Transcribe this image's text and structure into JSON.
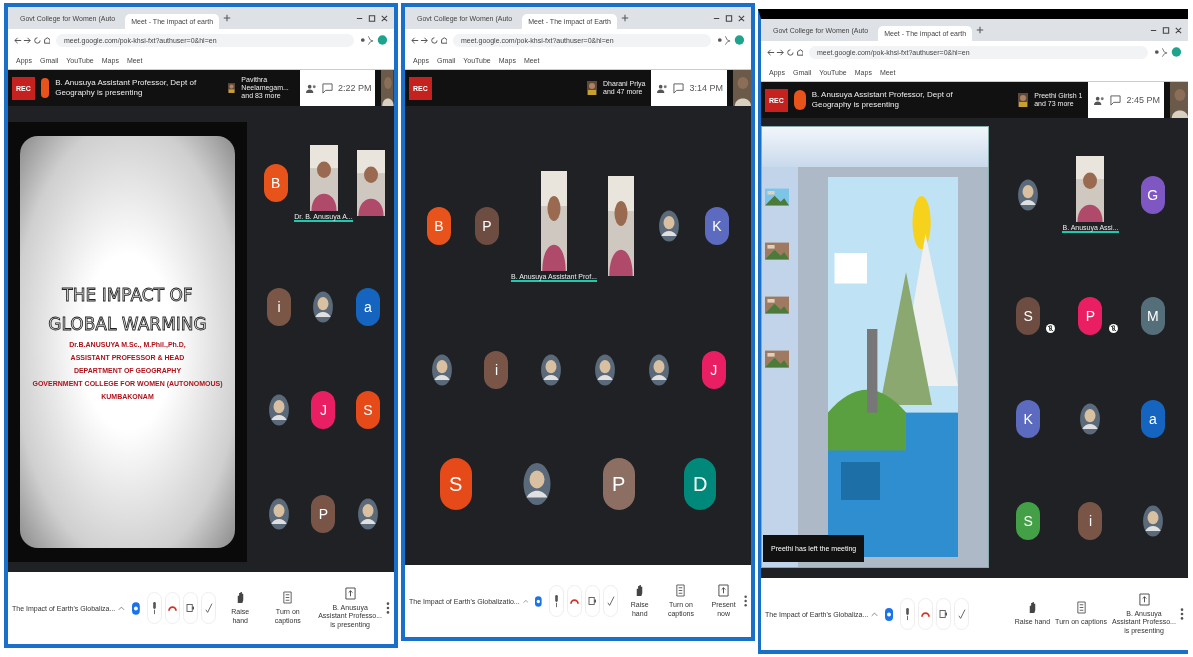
{
  "screens": [
    {
      "tabs": [
        {
          "label": "Govt College for Women (Auto",
          "selected": false
        },
        {
          "label": "Meet - The impact of earth",
          "selected": true
        }
      ],
      "url": "meet.google.com/pok-khsi-fxt?authuser=0&hl=en",
      "bookmarks": [
        "Apps",
        "Gmail",
        "YouTube",
        "Maps",
        "Meet"
      ],
      "rec": "REC",
      "presenter": "B. Anusuya Assistant Professor, Dept of Geography is presenting",
      "participants": [
        "Pavithra Neelamegam...",
        "and 83 more"
      ],
      "time": "2:22 PM",
      "stage": {
        "kind": "slide",
        "lines": [
          {
            "kind": "title",
            "text": "THE IMPACT OF"
          },
          {
            "kind": "title",
            "text": "GLOBAL WARMING"
          },
          {
            "kind": "text",
            "text": "Dr.B.ANUSUYA M.Sc., M.Phil.,Ph.D,"
          },
          {
            "kind": "text",
            "text": "ASSISTANT PROFESSOR & HEAD"
          },
          {
            "kind": "text",
            "text": "DEPARTMENT OF GEOGRAPHY"
          },
          {
            "kind": "text",
            "text": "GOVERNMENT COLLEGE FOR WOMEN (AUTONOMOUS)"
          },
          {
            "kind": "text",
            "text": "KUMBAKONAM"
          }
        ]
      },
      "rows": [
        [
          {
            "kind": "avatar",
            "letter": "B",
            "color": "#e8531c",
            "muted": false
          },
          {
            "kind": "video",
            "name": "Dr. B. Anusuya A..."
          },
          {
            "kind": "video"
          }
        ],
        [
          {
            "kind": "avatar",
            "letter": "i",
            "color": "#7a5646",
            "muted": false
          },
          {
            "kind": "picture"
          },
          {
            "kind": "avatar",
            "letter": "a",
            "color": "#1565c0",
            "muted": false
          }
        ],
        [
          {
            "kind": "picture"
          },
          {
            "kind": "avatar",
            "letter": "J",
            "color": "#e91e63",
            "muted": false
          },
          {
            "kind": "avatar",
            "letter": "S",
            "color": "#e64a19",
            "muted": false
          }
        ],
        [
          {
            "kind": "picture"
          },
          {
            "kind": "avatar",
            "letter": "P",
            "color": "#795548",
            "muted": false
          },
          {
            "kind": "picture"
          }
        ]
      ],
      "meeting_title": "The Impact of Earth's Globaliza...",
      "actions": [
        {
          "kind": "hand",
          "label": "Raise hand"
        },
        {
          "kind": "captions",
          "label": "Turn on captions"
        },
        {
          "kind": "present",
          "label": "B. Anusuya Assistant Professo... is presenting"
        }
      ]
    },
    {
      "tabs": [
        {
          "label": "Govt College for Women (Auto",
          "selected": false
        },
        {
          "label": "Meet - The impact of Earth",
          "selected": true
        }
      ],
      "url": "meet.google.com/pok-khsi-fxt?authuser=0&hl=en",
      "bookmarks": [
        "Apps",
        "Gmail",
        "YouTube",
        "Maps",
        "Meet"
      ],
      "rec": "REC",
      "participants": [
        "Dharani Priya",
        "and 47 more"
      ],
      "time": "3:14 PM",
      "rows": [
        [
          {
            "kind": "avatar",
            "letter": "B",
            "color": "#e8531c",
            "muted": false
          },
          {
            "kind": "avatar",
            "letter": "P",
            "color": "#6d4c41",
            "muted": false
          },
          {
            "kind": "video",
            "name": "B. Anusuya Assistant Prof..."
          },
          {
            "kind": "video"
          },
          {
            "kind": "picture"
          },
          {
            "kind": "avatar",
            "letter": "K",
            "color": "#5c6bc0",
            "muted": false
          }
        ],
        [
          {
            "kind": "picture"
          },
          {
            "kind": "avatar",
            "letter": "i",
            "color": "#795548",
            "muted": false
          },
          {
            "kind": "picture"
          },
          {
            "kind": "picture"
          },
          {
            "kind": "picture"
          },
          {
            "kind": "avatar",
            "letter": "J",
            "color": "#e91e63",
            "muted": false
          }
        ],
        [
          {
            "kind": "avatar",
            "letter": "S",
            "color": "#e64a19",
            "muted": false
          },
          {
            "kind": "picture"
          },
          {
            "kind": "avatar",
            "letter": "P",
            "color": "#8d6e63",
            "muted": false
          },
          {
            "kind": "avatar",
            "letter": "D",
            "color": "#00897b",
            "muted": false
          }
        ]
      ],
      "meeting_title": "The Impact of Earth's Globalizatio...",
      "actions": [
        {
          "kind": "hand",
          "label": "Raise hand"
        },
        {
          "kind": "captions",
          "label": "Turn on captions"
        },
        {
          "kind": "present",
          "label": "Present now"
        }
      ]
    },
    {
      "tabs": [
        {
          "label": "Govt College for Women (Auto",
          "selected": false
        },
        {
          "label": "Meet - The impact of earth",
          "selected": true
        }
      ],
      "url": "meet.google.com/pok-khsi-fxt?authuser=0&hl=en",
      "bookmarks": [
        "Apps",
        "Gmail",
        "YouTube",
        "Maps",
        "Meet"
      ],
      "rec": "REC",
      "presenter": "B. Anusuya Assistant Professor, Dept of Geography is presenting",
      "participants": [
        "Preethi Girish 1",
        "and 73 more"
      ],
      "time": "2:45 PM",
      "stage": {
        "kind": "app_window",
        "toast": "Preethi has left the meeting"
      },
      "rows": [
        [
          {
            "kind": "picture"
          },
          {
            "kind": "video",
            "name": "B. Anusuya Assi..."
          },
          {
            "kind": "avatar",
            "letter": "G",
            "color": "#7e57c2",
            "muted": false
          }
        ],
        [
          {
            "kind": "avatar",
            "letter": "S",
            "color": "#6d4c41",
            "muted": true
          },
          {
            "kind": "avatar",
            "letter": "P",
            "color": "#e91e63",
            "muted": true
          },
          {
            "kind": "avatar",
            "letter": "M",
            "color": "#546e7a",
            "muted": false
          }
        ],
        [
          {
            "kind": "avatar",
            "letter": "K",
            "color": "#5c6bc0",
            "muted": false
          },
          {
            "kind": "picture"
          },
          {
            "kind": "avatar",
            "letter": "a",
            "color": "#1565c0",
            "muted": false
          }
        ],
        [
          {
            "kind": "avatar",
            "letter": "S",
            "color": "#43a047",
            "muted": false
          },
          {
            "kind": "avatar",
            "letter": "i",
            "color": "#795548",
            "muted": false
          },
          {
            "kind": "picture"
          }
        ]
      ],
      "meeting_title": "The Impact of Earth's Globaliza...",
      "actions": [
        {
          "kind": "hand",
          "label": "Raise hand"
        },
        {
          "kind": "captions",
          "label": "Turn on captions"
        },
        {
          "kind": "present",
          "label": "B. Anusuya Assistant Professo... is presenting"
        }
      ]
    }
  ]
}
